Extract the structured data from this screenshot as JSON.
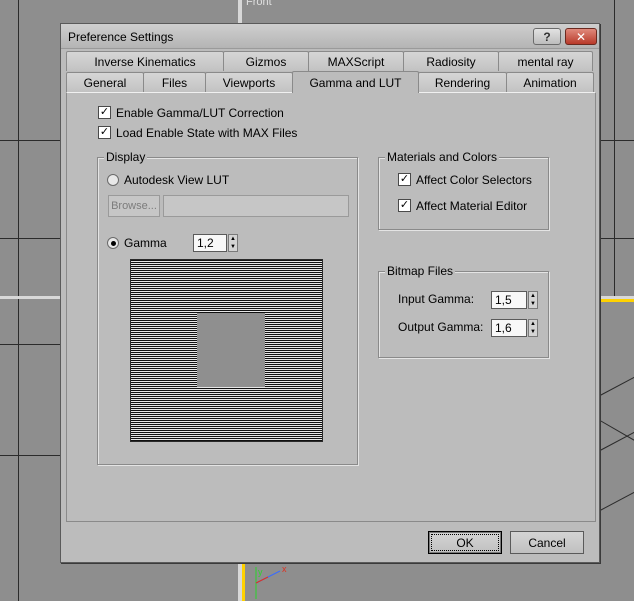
{
  "viewport": {
    "label": "Front",
    "accent_color": "#ffd200"
  },
  "dialog": {
    "title": "Preference Settings",
    "help_label": "?",
    "close_label": "✕"
  },
  "tabs": {
    "back_row": [
      "Inverse Kinematics",
      "Gizmos",
      "MAXScript",
      "Radiosity",
      "mental ray"
    ],
    "front_row": [
      "General",
      "Files",
      "Viewports",
      "Gamma and LUT",
      "Rendering",
      "Animation"
    ],
    "active": "Gamma and LUT"
  },
  "options": {
    "enable_gamma": {
      "label": "Enable Gamma/LUT Correction",
      "checked": true
    },
    "load_state": {
      "label": "Load Enable State with MAX Files",
      "checked": true
    }
  },
  "display": {
    "title": "Display",
    "autodesk_lut_label": "Autodesk View LUT",
    "browse_label": "Browse...",
    "path_value": "",
    "gamma_label": "Gamma",
    "gamma_value": "1,2",
    "selected": "gamma"
  },
  "materials": {
    "title": "Materials and Colors",
    "affect_color_selectors": {
      "label": "Affect Color Selectors",
      "checked": true
    },
    "affect_material_editor": {
      "label": "Affect Material Editor",
      "checked": true
    }
  },
  "bitmap": {
    "title": "Bitmap Files",
    "input_gamma_label": "Input Gamma:",
    "input_gamma_value": "1,5",
    "output_gamma_label": "Output Gamma:",
    "output_gamma_value": "1,6"
  },
  "buttons": {
    "ok_label": "OK",
    "cancel_label": "Cancel"
  },
  "check_mark": "✓"
}
